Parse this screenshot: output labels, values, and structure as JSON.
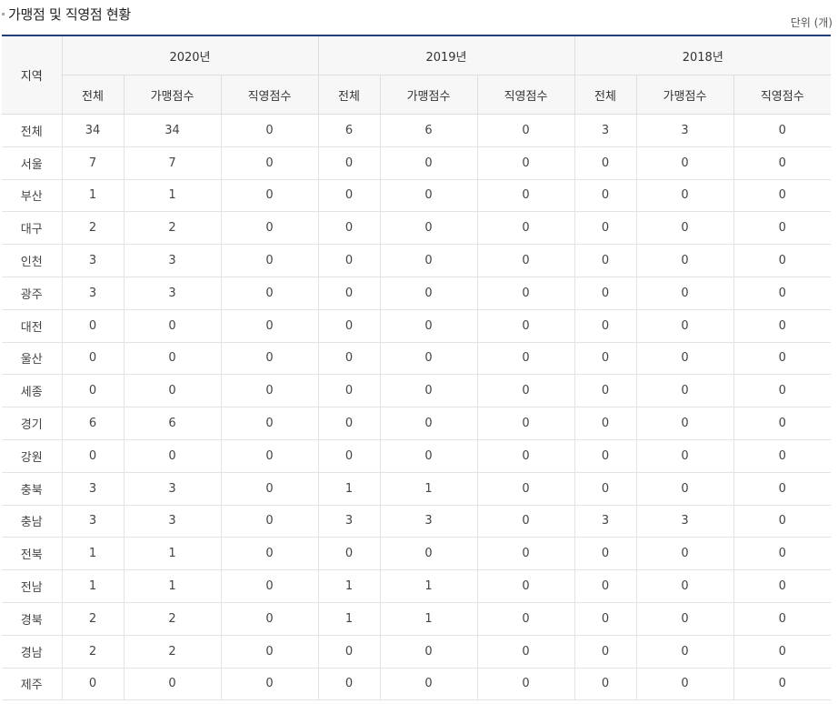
{
  "title": "가맹점 및 직영점 현황",
  "unit": "단위 (개)",
  "header": {
    "region": "지역",
    "years": [
      "2020년",
      "2019년",
      "2018년"
    ],
    "sub": [
      "전체",
      "가맹점수",
      "직영점수"
    ]
  },
  "rows": [
    {
      "region": "전체",
      "v": [
        "34",
        "34",
        "0",
        "6",
        "6",
        "0",
        "3",
        "3",
        "0"
      ]
    },
    {
      "region": "서울",
      "v": [
        "7",
        "7",
        "0",
        "0",
        "0",
        "0",
        "0",
        "0",
        "0"
      ]
    },
    {
      "region": "부산",
      "v": [
        "1",
        "1",
        "0",
        "0",
        "0",
        "0",
        "0",
        "0",
        "0"
      ]
    },
    {
      "region": "대구",
      "v": [
        "2",
        "2",
        "0",
        "0",
        "0",
        "0",
        "0",
        "0",
        "0"
      ]
    },
    {
      "region": "인천",
      "v": [
        "3",
        "3",
        "0",
        "0",
        "0",
        "0",
        "0",
        "0",
        "0"
      ]
    },
    {
      "region": "광주",
      "v": [
        "3",
        "3",
        "0",
        "0",
        "0",
        "0",
        "0",
        "0",
        "0"
      ]
    },
    {
      "region": "대전",
      "v": [
        "0",
        "0",
        "0",
        "0",
        "0",
        "0",
        "0",
        "0",
        "0"
      ]
    },
    {
      "region": "울산",
      "v": [
        "0",
        "0",
        "0",
        "0",
        "0",
        "0",
        "0",
        "0",
        "0"
      ]
    },
    {
      "region": "세종",
      "v": [
        "0",
        "0",
        "0",
        "0",
        "0",
        "0",
        "0",
        "0",
        "0"
      ]
    },
    {
      "region": "경기",
      "v": [
        "6",
        "6",
        "0",
        "0",
        "0",
        "0",
        "0",
        "0",
        "0"
      ]
    },
    {
      "region": "강원",
      "v": [
        "0",
        "0",
        "0",
        "0",
        "0",
        "0",
        "0",
        "0",
        "0"
      ]
    },
    {
      "region": "충북",
      "v": [
        "3",
        "3",
        "0",
        "1",
        "1",
        "0",
        "0",
        "0",
        "0"
      ]
    },
    {
      "region": "충남",
      "v": [
        "3",
        "3",
        "0",
        "3",
        "3",
        "0",
        "3",
        "3",
        "0"
      ]
    },
    {
      "region": "전북",
      "v": [
        "1",
        "1",
        "0",
        "0",
        "0",
        "0",
        "0",
        "0",
        "0"
      ]
    },
    {
      "region": "전남",
      "v": [
        "1",
        "1",
        "0",
        "1",
        "1",
        "0",
        "0",
        "0",
        "0"
      ]
    },
    {
      "region": "경북",
      "v": [
        "2",
        "2",
        "0",
        "1",
        "1",
        "0",
        "0",
        "0",
        "0"
      ]
    },
    {
      "region": "경남",
      "v": [
        "2",
        "2",
        "0",
        "0",
        "0",
        "0",
        "0",
        "0",
        "0"
      ]
    },
    {
      "region": "제주",
      "v": [
        "0",
        "0",
        "0",
        "0",
        "0",
        "0",
        "0",
        "0",
        "0"
      ]
    }
  ]
}
